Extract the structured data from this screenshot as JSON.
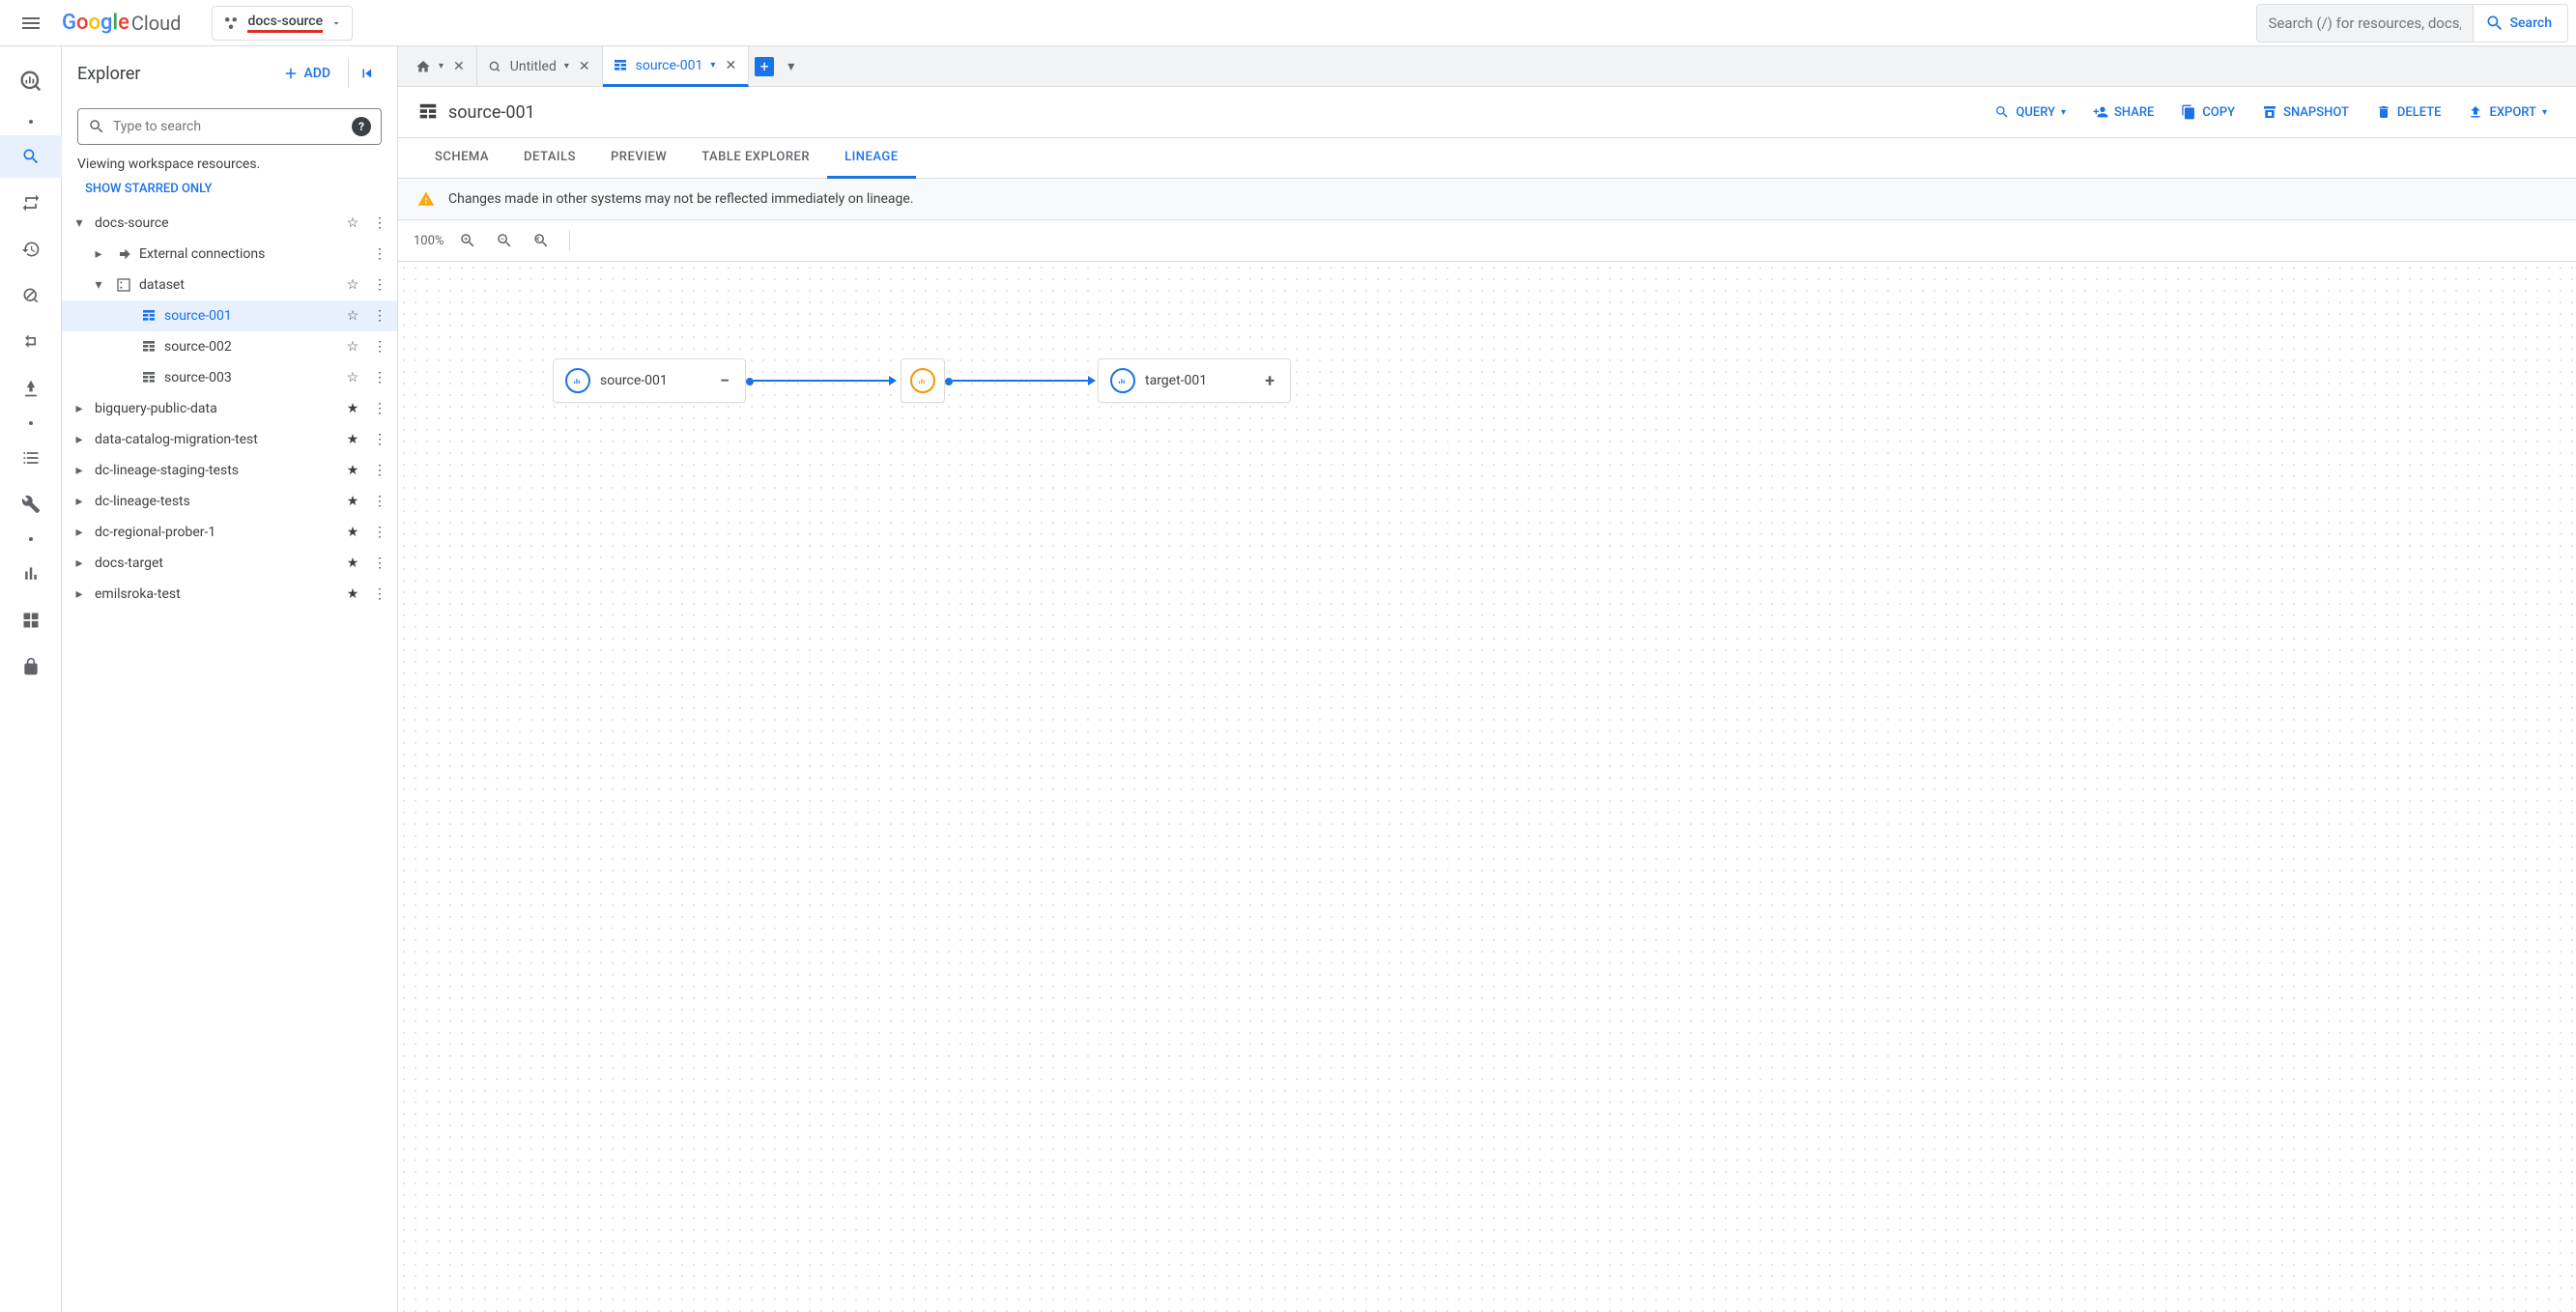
{
  "header": {
    "logo_cloud": "Cloud",
    "project_name": "docs-source",
    "search_placeholder": "Search (/) for resources, docs, products, and more",
    "search_button": "Search"
  },
  "explorer": {
    "title": "Explorer",
    "add_label": "ADD",
    "search_placeholder": "Type to search",
    "viewing_label": "Viewing workspace resources.",
    "show_starred_label": "SHOW STARRED ONLY",
    "tree": {
      "docs_source": "docs-source",
      "external_connections": "External connections",
      "dataset": "dataset",
      "source_001": "source-001",
      "source_002": "source-002",
      "source_003": "source-003",
      "bigquery_public": "bigquery-public-data",
      "data_catalog": "data-catalog-migration-test",
      "dc_staging": "dc-lineage-staging-tests",
      "dc_tests": "dc-lineage-tests",
      "dc_regional": "dc-regional-prober-1",
      "docs_target": "docs-target",
      "emilsroka": "emilsroka-test"
    }
  },
  "tabs": {
    "untitled": "Untitled",
    "source_001": "source-001"
  },
  "table": {
    "title": "source-001",
    "actions": {
      "query": "QUERY",
      "share": "SHARE",
      "copy": "COPY",
      "snapshot": "SNAPSHOT",
      "delete": "DELETE",
      "export": "EXPORT"
    }
  },
  "subtabs": {
    "schema": "SCHEMA",
    "details": "DETAILS",
    "preview": "PREVIEW",
    "table_explorer": "TABLE EXPLORER",
    "lineage": "LINEAGE"
  },
  "warning": "Changes made in other systems may not be reflected immediately on lineage.",
  "toolbar": {
    "zoom": "100%"
  },
  "lineage": {
    "source": "source-001",
    "target": "target-001"
  }
}
